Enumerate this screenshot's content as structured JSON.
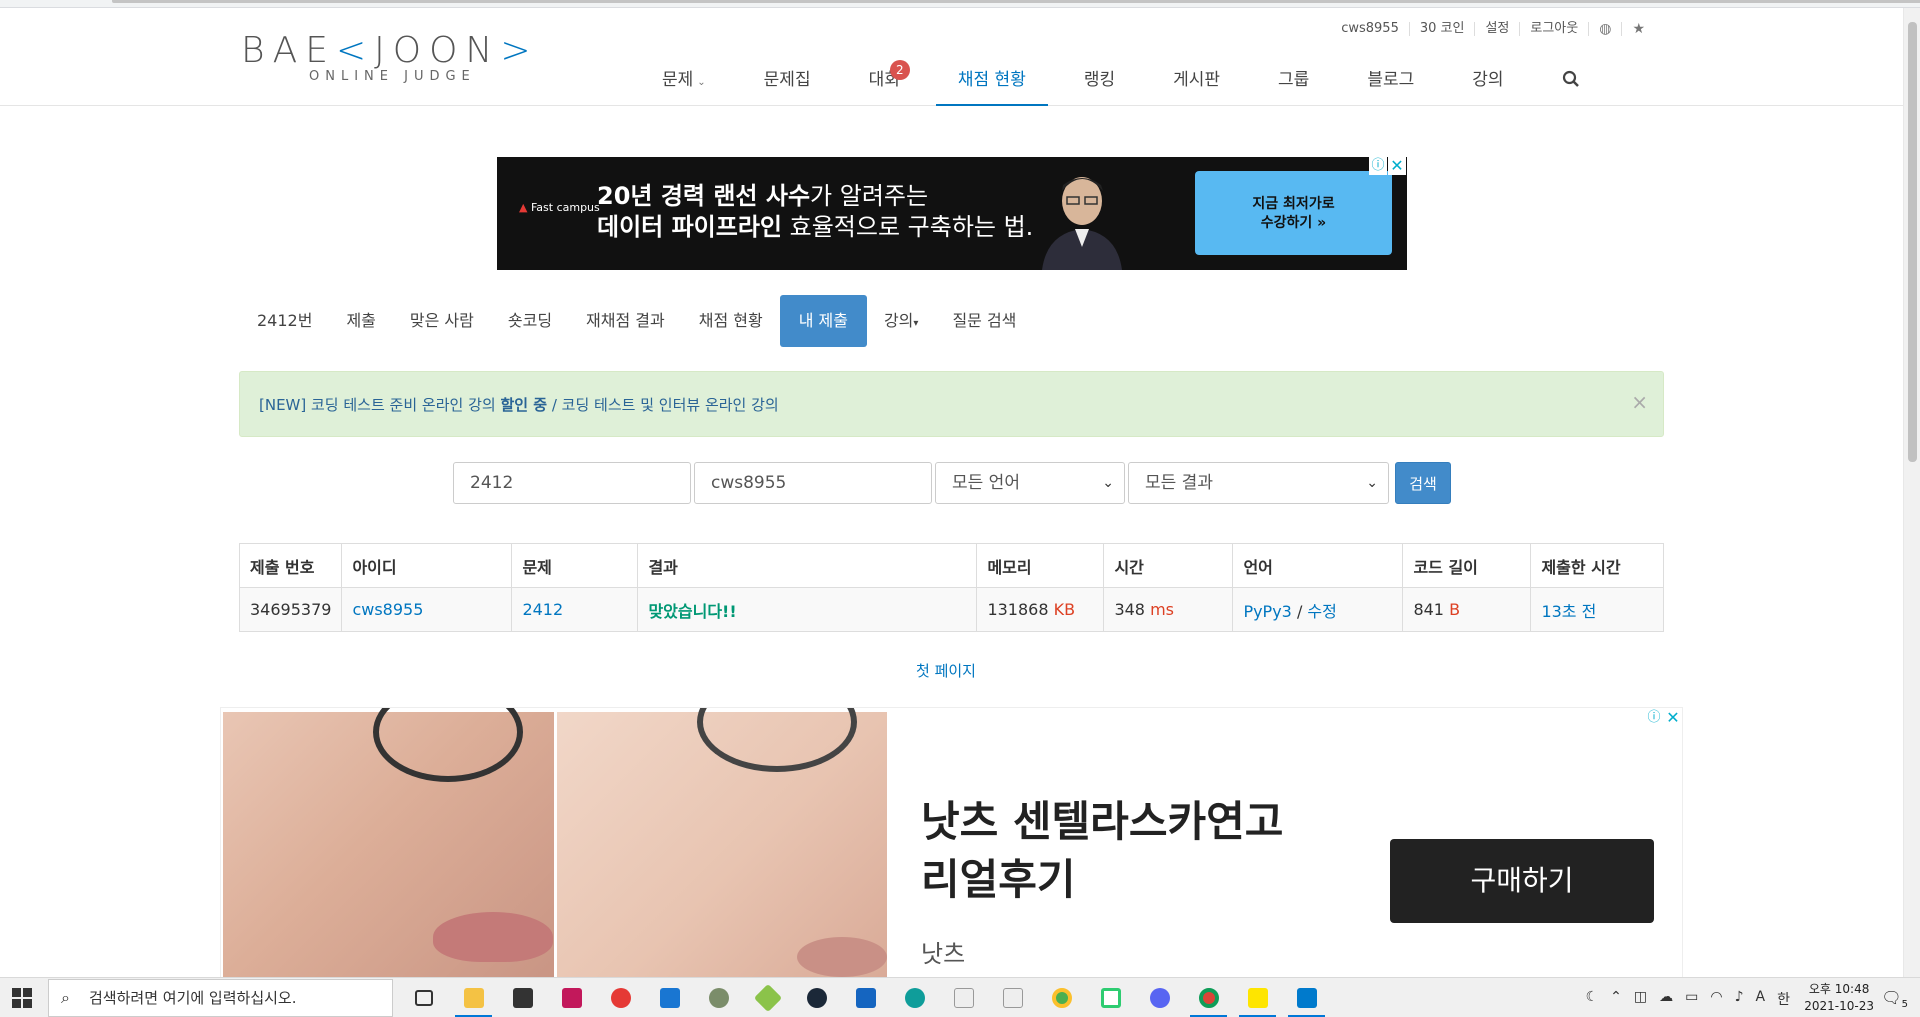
{
  "header": {
    "logo_main": "BAE",
    "logo_bracket": "<",
    "logo_main2": "JOON",
    "logo_bracket2": ">",
    "logo_sub": "ONLINE JUDGE",
    "toplinks": [
      "cws8955",
      "30 코인",
      "설정",
      "로그아웃"
    ],
    "nav": [
      {
        "label": "문제",
        "caret": "⌄"
      },
      {
        "label": "문제집"
      },
      {
        "label": "대회",
        "badge": "2"
      },
      {
        "label": "채점 현황",
        "active": true
      },
      {
        "label": "랭킹"
      },
      {
        "label": "게시판"
      },
      {
        "label": "그룹"
      },
      {
        "label": "블로그"
      },
      {
        "label": "강의"
      }
    ]
  },
  "ad_top": {
    "brand_logo": "Fast campus",
    "line1_bold": "20년 경력 랜선 사수",
    "line1_light": "가 알려주는",
    "line2_bold": "데이터 파이프라인",
    "line2_light": " 효율적으로 구축하는 법.",
    "cta_line1": "지금 최저가로",
    "cta_line2": "수강하기 »"
  },
  "subtabs": [
    "2412번",
    "제출",
    "맞은 사람",
    "숏코딩",
    "재채점 결과",
    "채점 현황",
    "내 제출",
    "강의",
    "질문 검색"
  ],
  "subtabs_active": "내 제출",
  "alert": {
    "text_prefix": "[NEW] 코딩 테스트 준비 온라인 강의 ",
    "text_bold": "할인 중",
    "text_suffix": " / 코딩 테스트 및 인터뷰 온라인 강의",
    "close": "×"
  },
  "search": {
    "problem_id": "2412",
    "user_id": "cws8955",
    "language": "모든 언어",
    "result": "모든 결과",
    "button": "검색"
  },
  "table": {
    "headers": [
      "제출 번호",
      "아이디",
      "문제",
      "결과",
      "메모리",
      "시간",
      "언어",
      "코드 길이",
      "제출한 시간"
    ],
    "rows": [
      {
        "submission": "34695379",
        "user": "cws8955",
        "problem": "2412",
        "result": "맞았습니다!!",
        "memory": "131868",
        "memory_unit": "KB",
        "time": "348",
        "time_unit": "ms",
        "language": "PyPy3",
        "lang_sep": " / ",
        "edit": "수정",
        "code_length": "841",
        "code_unit": "B",
        "submitted": "13초 전"
      }
    ]
  },
  "pagination": {
    "first_page": "첫 페이지"
  },
  "ad_bottom": {
    "title_line1": "낫츠 센텔라스카연고",
    "title_line2": "리얼후기",
    "advertiser": "낫츠",
    "button": "구매하기"
  },
  "taskbar": {
    "search_placeholder": "검색하려면 여기에 입력하십시오.",
    "tray_ime": "A",
    "tray_lang": "한",
    "time": "오후 10:48",
    "date": "2021-10-23",
    "notif_count": "5"
  },
  "colors": {
    "accent": "#0076c0",
    "active_tab": "#428bca",
    "ok": "#009874",
    "unit": "#dd4124",
    "badge": "#d9534f"
  }
}
